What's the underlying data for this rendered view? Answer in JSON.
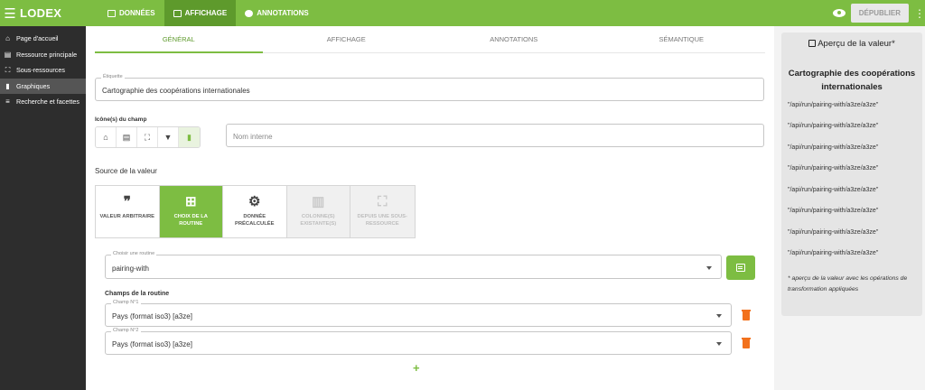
{
  "app": {
    "name": "LODEX"
  },
  "topnav": {
    "tabs": [
      {
        "label": "DONNÉES",
        "icon": "table-icon"
      },
      {
        "label": "AFFICHAGE",
        "icon": "image-icon",
        "active": true
      },
      {
        "label": "ANNOTATIONS",
        "icon": "comment-icon"
      }
    ],
    "publish_label": "DÉPUBLIER"
  },
  "sidebar": {
    "items": [
      {
        "label": "Page d'accueil",
        "icon": "home-icon"
      },
      {
        "label": "Ressource principale",
        "icon": "document-icon"
      },
      {
        "label": "Sous-ressources",
        "icon": "frame-icon"
      },
      {
        "label": "Graphiques",
        "icon": "bar-chart-icon",
        "active": true
      },
      {
        "label": "Recherche et facettes",
        "icon": "search-list-icon"
      }
    ]
  },
  "subtabs": [
    "GÉNÉRAL",
    "AFFICHAGE",
    "ANNOTATIONS",
    "SÉMANTIQUE"
  ],
  "form": {
    "label_field": {
      "label": "Étiquette",
      "value": "Cartographie des coopérations internationales"
    },
    "icons_label": "Icône(s) du champ",
    "icons": [
      "home-icon",
      "document-icon",
      "frame-icon",
      "filter-icon",
      "bar-chart-icon"
    ],
    "internal_name": {
      "placeholder": "Nom interne"
    },
    "source_title": "Source de la valeur",
    "sources": [
      {
        "label": "VALEUR ARBITRAIRE",
        "icon": "quote-icon",
        "state": "normal"
      },
      {
        "label": "CHOIX DE LA ROUTINE",
        "icon": "routine-icon",
        "state": "active"
      },
      {
        "label": "DONNÉE PRÉCALCULÉE",
        "icon": "gear-icon",
        "state": "normal"
      },
      {
        "label": "COLONNE(S) EXISTANTE(S)",
        "icon": "columns-icon",
        "state": "disabled"
      },
      {
        "label": "DEPUIS UNE SOUS-RESSOURCE",
        "icon": "frame-icon",
        "state": "disabled"
      }
    ],
    "routine": {
      "label": "Choisir une routine",
      "value": "pairing-with"
    },
    "routine_fields_title": "Champs de la routine",
    "routine_fields": [
      {
        "label": "Champ N°1",
        "value": "Pays (format iso3) [a3ze]"
      },
      {
        "label": "Champ N°2",
        "value": "Pays (format iso3) [a3ze]"
      }
    ]
  },
  "preview": {
    "heading": "Aperçu de la valeur*",
    "title": "Cartographie des coopérations internationales",
    "lines": [
      "\"/api/run/pairing-with/a3ze/a3ze\"",
      "\"/api/run/pairing-with/a3ze/a3ze\"",
      "\"/api/run/pairing-with/a3ze/a3ze\"",
      "\"/api/run/pairing-with/a3ze/a3ze\"",
      "\"/api/run/pairing-with/a3ze/a3ze\"",
      "\"/api/run/pairing-with/a3ze/a3ze\"",
      "\"/api/run/pairing-with/a3ze/a3ze\"",
      "\"/api/run/pairing-with/a3ze/a3ze\""
    ],
    "note": "* aperçu de la valeur avec les opérations de transformation appliquées"
  },
  "colors": {
    "brand": "#7dbd42",
    "brand_dark": "#5e9a2c",
    "sidebar": "#2d2d2d",
    "danger": "#f2711c"
  }
}
